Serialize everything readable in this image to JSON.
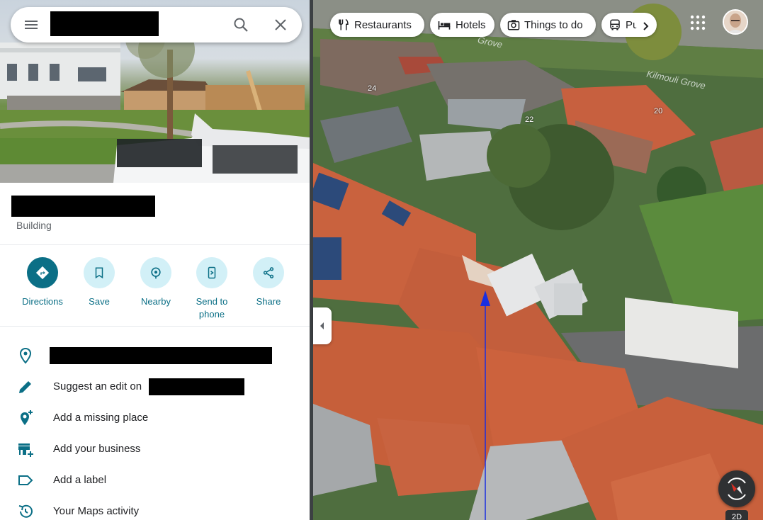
{
  "search": {
    "query": ""
  },
  "place": {
    "name": "",
    "type": "Building"
  },
  "actions": [
    {
      "label": "Directions"
    },
    {
      "label": "Save"
    },
    {
      "label": "Nearby"
    },
    {
      "label": "Send to phone"
    },
    {
      "label": "Share"
    }
  ],
  "rows": {
    "address": "",
    "suggest_edit": "Suggest an edit on",
    "add_missing_place": "Add a missing place",
    "add_business": "Add your business",
    "add_label": "Add a label",
    "maps_activity": "Your Maps activity"
  },
  "map": {
    "chips": [
      {
        "label": "Restaurants",
        "icon": "fork-knife-icon"
      },
      {
        "label": "Hotels",
        "icon": "bed-icon"
      },
      {
        "label": "Things to do",
        "icon": "camera-icon"
      },
      {
        "label": "Pu",
        "icon": "bus-icon"
      }
    ],
    "street_names": [
      "Grove",
      "Kilmouli Grove"
    ],
    "house_numbers": [
      "24",
      "22",
      "20"
    ],
    "toggle_3d_label": "2D"
  },
  "colors": {
    "accent": "#0b6f86",
    "accent_light": "#d2f0f7",
    "direction_line": "#1a2fe0"
  }
}
